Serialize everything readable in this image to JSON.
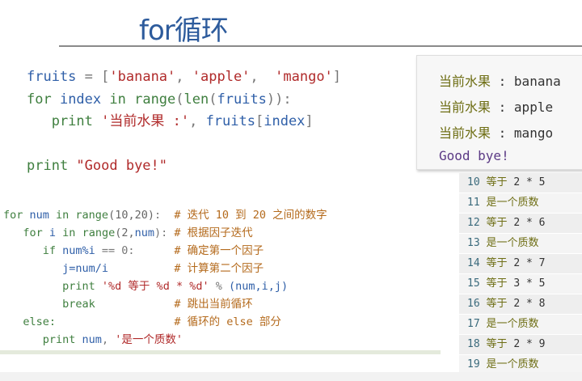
{
  "title": "for循环",
  "code_block_1": [
    [
      [
        "fruits",
        "id"
      ],
      [
        " = ",
        "op"
      ],
      [
        "[",
        "op"
      ],
      [
        "'banana'",
        "str"
      ],
      [
        ", ",
        "op"
      ],
      [
        "'apple'",
        "str"
      ],
      [
        ",  ",
        "op"
      ],
      [
        "'mango'",
        "str"
      ],
      [
        "]",
        "op"
      ]
    ],
    [
      [
        "for ",
        "kw"
      ],
      [
        "index ",
        "id"
      ],
      [
        "in ",
        "kw"
      ],
      [
        "range",
        "kw"
      ],
      [
        "(",
        "op"
      ],
      [
        "len",
        "kw"
      ],
      [
        "(",
        "op"
      ],
      [
        "fruits",
        "id"
      ],
      [
        "))",
        "op"
      ],
      [
        ":",
        "op"
      ]
    ],
    [
      [
        "   print ",
        "kw"
      ],
      [
        "'当前水果 :'",
        "str"
      ],
      [
        ", ",
        "op"
      ],
      [
        "fruits",
        "id"
      ],
      [
        "[",
        "op"
      ],
      [
        "index",
        "id"
      ],
      [
        "]",
        "op"
      ]
    ],
    [
      [
        "",
        "op"
      ]
    ],
    [
      [
        "print ",
        "kw"
      ],
      [
        "\"Good bye!\"",
        "str"
      ]
    ]
  ],
  "code_block_2": [
    [
      [
        "for ",
        "kw"
      ],
      [
        "num ",
        "id"
      ],
      [
        "in ",
        "kw"
      ],
      [
        "range",
        "kw"
      ],
      [
        "(10,20)",
        "num"
      ],
      [
        ":  ",
        "op"
      ],
      [
        "# 迭代 10 到 20 之间的数字",
        "cm"
      ]
    ],
    [
      [
        "   for ",
        "kw"
      ],
      [
        "i ",
        "id"
      ],
      [
        "in ",
        "kw"
      ],
      [
        "range",
        "kw"
      ],
      [
        "(2,",
        "num"
      ],
      [
        "num",
        "id"
      ],
      [
        "):",
        "op"
      ],
      [
        " # 根据因子迭代",
        "cm"
      ]
    ],
    [
      [
        "      if ",
        "kw"
      ],
      [
        "num%i",
        "id"
      ],
      [
        " == 0:      ",
        "op"
      ],
      [
        "# 确定第一个因子",
        "cm"
      ]
    ],
    [
      [
        "         j=num/i",
        "id"
      ],
      [
        "          ",
        "op"
      ],
      [
        "# 计算第二个因子",
        "cm"
      ]
    ],
    [
      [
        "         print ",
        "kw"
      ],
      [
        "'%d 等于 %d * %d'",
        "str"
      ],
      [
        " % ",
        "op"
      ],
      [
        "(num,i,j)",
        "id"
      ]
    ],
    [
      [
        "         break",
        "kw"
      ],
      [
        "            ",
        "op"
      ],
      [
        "# 跳出当前循环",
        "cm"
      ]
    ],
    [
      [
        "   else:",
        "kw"
      ],
      [
        "                  ",
        "op"
      ],
      [
        "# 循环的 else 部分",
        "cm"
      ]
    ],
    [
      [
        "      print ",
        "kw"
      ],
      [
        "num",
        "id"
      ],
      [
        ", ",
        "op"
      ],
      [
        "'是一个质数'",
        "str"
      ]
    ]
  ],
  "output_panel": [
    {
      "label": "当前水果",
      "sep": " : ",
      "value": "banana"
    },
    {
      "label": "当前水果",
      "sep": " : ",
      "value": "apple"
    },
    {
      "label": "当前水果",
      "sep": " : ",
      "value": "mango"
    }
  ],
  "output_goodbye": "Good bye!",
  "prime_output": [
    {
      "n": "10",
      "text": "等于",
      "expr": "2 * 5"
    },
    {
      "n": "11",
      "text": "是一个质数",
      "expr": ""
    },
    {
      "n": "12",
      "text": "等于",
      "expr": "2 * 6"
    },
    {
      "n": "13",
      "text": "是一个质数",
      "expr": ""
    },
    {
      "n": "14",
      "text": "等于",
      "expr": "2 * 7"
    },
    {
      "n": "15",
      "text": "等于",
      "expr": "3 * 5"
    },
    {
      "n": "16",
      "text": "等于",
      "expr": "2 * 8"
    },
    {
      "n": "17",
      "text": "是一个质数",
      "expr": ""
    },
    {
      "n": "18",
      "text": "等于",
      "expr": "2 * 9"
    },
    {
      "n": "19",
      "text": "是一个质数",
      "expr": ""
    }
  ],
  "colors": {
    "title": "#2d5b9c",
    "keyword": "#3f7f3f",
    "identifier": "#2f5fa8",
    "string": "#b02a2a",
    "comment": "#b46a1c"
  }
}
